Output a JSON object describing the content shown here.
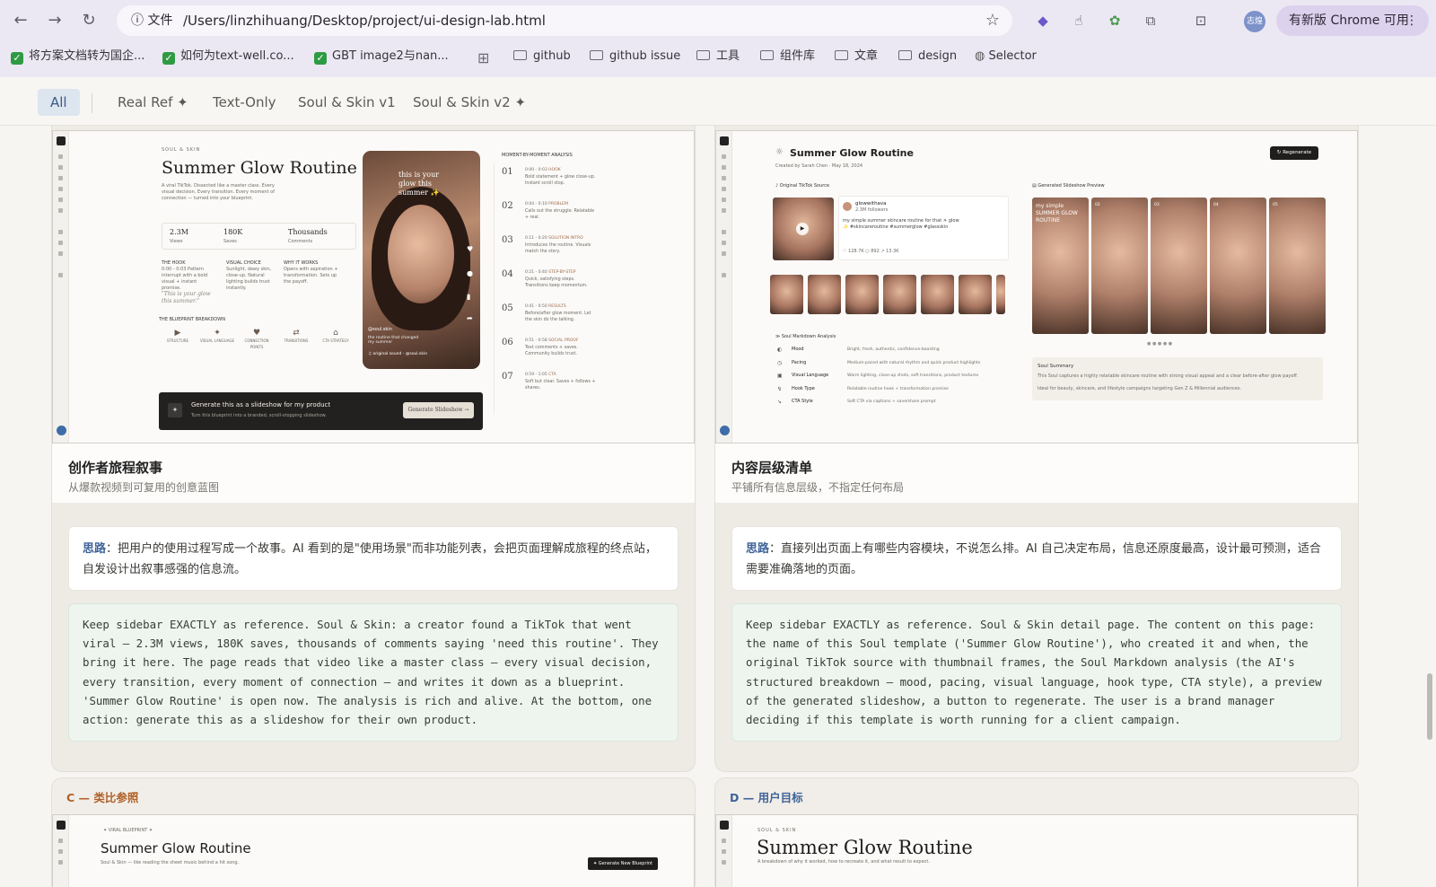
{
  "browser": {
    "url": "/Users/linzhihuang/Desktop/project/ui-design-lab.html",
    "file_label": "文件",
    "profile_label": "志煌",
    "update_label": "有新版 Chrome 可用",
    "bookmarks": [
      {
        "type": "check",
        "label": "将方案文档转为国企..."
      },
      {
        "type": "check",
        "label": "如何为text-well.co..."
      },
      {
        "type": "check",
        "label": "GBT image2与nan..."
      },
      {
        "type": "folder",
        "label": "github"
      },
      {
        "type": "folder",
        "label": "github issue"
      },
      {
        "type": "folder",
        "label": "工具"
      },
      {
        "type": "folder",
        "label": "组件库"
      },
      {
        "type": "folder",
        "label": "文章"
      },
      {
        "type": "folder",
        "label": "design"
      },
      {
        "type": "globe",
        "label": "Selector"
      }
    ]
  },
  "filters": [
    "All",
    "Real Ref ✦",
    "Text-Only",
    "Soul & Skin v1",
    "Soul & Skin v2 ✦"
  ],
  "cards": [
    {
      "title": "创作者旅程叙事",
      "subtitle": "从爆款视频到可复用的创意蓝图",
      "idea_label": "思路",
      "idea_text": "：把用户的使用过程写成一个故事。AI 看到的是\"使用场景\"而非功能列表，会把页面理解成旅程的终点站，自发设计出叙事感强的信息流。",
      "prompt": "Keep sidebar EXACTLY as reference. Soul & Skin: a creator found a TikTok that went viral — 2.3M views, 180K saves, thousands of comments saying 'need this routine'. They bring it here. The page reads that video like a master class — every visual decision, every transition, every moment of connection — and writes it down as a blueprint. 'Summer Glow Routine' is open now. The analysis is rich and alive. At the bottom, one action: generate this as a slideshow for their own product."
    },
    {
      "title": "内容层级清单",
      "subtitle": "平铺所有信息层级，不指定任何布局",
      "idea_label": "思路",
      "idea_text": "：直接列出页面上有哪些内容模块，不说怎么排。AI 自己决定布局，信息还原度最高，设计最可预测，适合需要准确落地的页面。",
      "prompt": "Keep sidebar EXACTLY as reference. Soul & Skin detail page. The content on this page: the name of this Soul template ('Summer Glow Routine'), who created it and when, the original TikTok source with thumbnail frames, the Soul Markdown analysis (the AI's structured breakdown — mood, pacing, visual language, hook type, CTA style), a preview of the generated slideshow, a button to regenerate. The user is a brand manager deciding if this template is worth running for a client campaign."
    }
  ],
  "sections": [
    {
      "label": "C — 类比参照",
      "color": "#b0622a"
    },
    {
      "label": "D — 用户目标",
      "color": "#3f6298"
    }
  ],
  "mockA": {
    "eyebrow": "SOUL & SKIN",
    "title": "Summer Glow Routine",
    "desc": "A viral TikTok. Dissected like a master class. Every visual decision. Every transition. Every moment of connection — turned into your blueprint.",
    "stats": [
      {
        "value": "2.3M",
        "label": "Views"
      },
      {
        "value": "180K",
        "label": "Saves"
      },
      {
        "value": "Thousands",
        "label": "Comments"
      }
    ],
    "cols": [
      {
        "h": "THE HOOK",
        "t": "0:00 - 0:03 Pattern interrupt with a bold visual + instant promise."
      },
      {
        "h": "VISUAL CHOICE",
        "t": "Sunlight, dewy skin, close-up. Natural lighting builds trust instantly."
      },
      {
        "h": "WHY IT WORKS",
        "t": "Opens with aspiration + transformation. Sets up the payoff."
      }
    ],
    "quote": "\"This is your glow this summer.\"",
    "blueprint_title": "THE BLUEPRINT BREAKDOWN",
    "blueprint": [
      "STRUCTURE",
      "VISUAL LANGUAGE",
      "CONNECTION POINTS",
      "TRANSITIONS",
      "CTA STRATEGY"
    ],
    "phone_caption": "this is your glow this summer ✨",
    "phone_user": "@soul.skin",
    "phone_sub": "the routine that changed my summer",
    "phone_sound": "♫ original sound - @soul.skin",
    "moments_title": "MOMENT-BY-MOMENT ANALYSIS",
    "moments": [
      {
        "n": "01",
        "time": "0:00 - 0:03",
        "tag": "HOOK",
        "t": "Bold statement + glow close-up. Instant scroll stop."
      },
      {
        "n": "02",
        "time": "0:04 - 0:10",
        "tag": "PROBLEM",
        "t": "Calls out the struggle. Relatable + real."
      },
      {
        "n": "03",
        "time": "0:11 - 0:20",
        "tag": "SOLUTION INTRO",
        "t": "Introduces the routine. Visuals match the story."
      },
      {
        "n": "04",
        "time": "0:21 - 0:40",
        "tag": "STEP-BY-STEP",
        "t": "Quick, satisfying steps. Transitions keep momentum."
      },
      {
        "n": "05",
        "time": "0:41 - 0:50",
        "tag": "RESULTS",
        "t": "Before/after glow moment. Let the skin do the talking."
      },
      {
        "n": "06",
        "time": "0:51 - 0:58",
        "tag": "SOCIAL PROOF",
        "t": "Text comments + saves. Community builds trust."
      },
      {
        "n": "07",
        "time": "0:59 - 1:05",
        "tag": "CTA",
        "t": "Soft but clear. Saves + follows + shares."
      }
    ],
    "cta_title": "Generate this as a slideshow for my product",
    "cta_sub": "Turn this blueprint into a branded, scroll-stopping slideshow.",
    "cta_button": "Generate Slideshow →"
  },
  "mockB": {
    "title": "Summer Glow Routine",
    "meta": "Created by  Sarah Chen  ·  May 18, 2024",
    "regen": "Regenerate",
    "source_label": "Original TikTok Source",
    "handle": "glowwithava",
    "followers": "2.3M followers",
    "caption": "my simple summer skincare routine for that ☀ glow ✨ #skincareroutine #summerglow #glassskin",
    "counts": "♡ 128.7K   ○ 892   ↗ 13.3K",
    "analysis_label": "Soul Markdown Analysis",
    "rows": [
      {
        "k": "Mood",
        "v": "Bright, fresh, authentic, confidence-boosting"
      },
      {
        "k": "Pacing",
        "v": "Medium-paced with natural rhythm and quick product highlights"
      },
      {
        "k": "Visual Language",
        "v": "Warm lighting, close-up shots, soft transitions, product textures"
      },
      {
        "k": "Hook Type",
        "v": "Relatable routine hook + transformation promise"
      },
      {
        "k": "CTA Style",
        "v": "Soft CTA via captions + save/share prompt"
      }
    ],
    "preview_label": "Generated Slideshow Preview",
    "slides": [
      "my simple SUMMER GLOW ROUTINE",
      "02",
      "03",
      "04",
      "05"
    ],
    "summary_title": "Soul Summary",
    "summary_1": "This Soul captures a highly relatable skincare routine with strong visual appeal and a clear before-after glow payoff.",
    "summary_2": "Ideal for beauty, skincare, and lifestyle campaigns targeting Gen Z & Millennial audiences."
  },
  "mockC": {
    "badge": "✦ VIRAL BLUEPRINT ✦",
    "title": "Summer Glow Routine",
    "sub": "Soul & Skin — like reading the sheet music behind a hit song.",
    "button": "Generate New Blueprint"
  },
  "mockD": {
    "eyebrow": "SOUL & SKIN",
    "title": "Summer Glow Routine",
    "sub": "A breakdown of why it worked, how to recreate it, and what result to expect."
  }
}
